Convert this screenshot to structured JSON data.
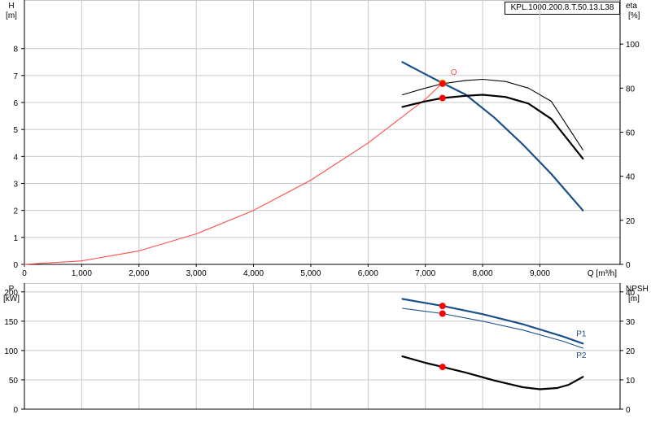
{
  "model_label": "KPL.1000.200.8.T.50.13.L38",
  "colors": {
    "h_curve": "#1b4f8a",
    "system_curve": "#ff4d4d",
    "eta_curves": "#000000",
    "p1": "#1b4f8a",
    "p2": "#1b4f8a",
    "npsh": "#000000",
    "duty_point": "#ff0000",
    "op_point_marker": "#ffd400",
    "grid": "#c8c8c8"
  },
  "chart_data": [
    {
      "type": "line",
      "x_axis": {
        "label": "Q [m³/h]",
        "range": [
          0,
          10400
        ],
        "ticks": [
          0,
          1000,
          2000,
          3000,
          4000,
          5000,
          6000,
          7000,
          8000,
          9000
        ],
        "tick_labels": [
          "0",
          "1,000",
          "2,000",
          "3,000",
          "4,000",
          "5,000",
          "6,000",
          "7,000",
          "8,000",
          "9,000"
        ]
      },
      "left_axis": {
        "label_top": "H",
        "label_unit": "[m]",
        "range": [
          0,
          9.8
        ],
        "ticks": [
          0,
          1,
          2,
          3,
          4,
          5,
          6,
          7,
          8
        ],
        "tick_labels": [
          "0",
          "1",
          "2",
          "3",
          "4",
          "5",
          "6",
          "7",
          "8"
        ]
      },
      "right_axis": {
        "label_top": "eta",
        "label_unit": "[%]",
        "range": [
          0,
          120
        ],
        "ticks": [
          0,
          20,
          40,
          60,
          80,
          100
        ],
        "tick_labels": [
          "0",
          "20",
          "40",
          "60",
          "80",
          "100"
        ]
      },
      "grid": true,
      "series": [
        {
          "id": "h",
          "axis": "left",
          "style": "thick",
          "x": [
            6600,
            7000,
            7300,
            7700,
            8200,
            8700,
            9200,
            9750
          ],
          "y": [
            7.5,
            7.05,
            6.72,
            6.3,
            5.45,
            4.45,
            3.35,
            2.0
          ]
        },
        {
          "id": "system",
          "axis": "left",
          "style": "thin",
          "x": [
            0,
            1000,
            2000,
            3000,
            4000,
            5000,
            6000,
            7000,
            7300
          ],
          "y": [
            0,
            0.13,
            0.5,
            1.13,
            2.0,
            3.12,
            4.5,
            6.12,
            6.72
          ],
          "end_label": "O"
        },
        {
          "id": "eta1",
          "axis": "right",
          "style": "thin",
          "x": [
            6600,
            7000,
            7300,
            7700,
            8000,
            8400,
            8800,
            9200,
            9750
          ],
          "y": [
            77,
            80,
            82,
            83.5,
            84,
            83,
            80,
            74,
            52
          ]
        },
        {
          "id": "eta2",
          "axis": "right",
          "style": "thick",
          "x": [
            6600,
            7000,
            7300,
            7700,
            8000,
            8400,
            8800,
            9200,
            9750
          ],
          "y": [
            71.5,
            74,
            75.5,
            76.5,
            77,
            76,
            73,
            66,
            48
          ]
        }
      ],
      "duty_points": [
        {
          "axis": "left",
          "x": 7300,
          "y": 6.72,
          "marker": "yellow"
        },
        {
          "axis": "right",
          "x": 7300,
          "y": 82,
          "marker": "red"
        },
        {
          "axis": "right",
          "x": 7300,
          "y": 75.5,
          "marker": "red"
        }
      ]
    },
    {
      "type": "line",
      "x_axis": {
        "range": [
          0,
          10400
        ]
      },
      "left_axis": {
        "label_top": "P",
        "label_unit": "[kW]",
        "range": [
          0,
          215
        ],
        "ticks": [
          0,
          50,
          100,
          150,
          200
        ],
        "tick_labels": [
          "0",
          "50",
          "100",
          "150",
          "200"
        ]
      },
      "right_axis": {
        "label_top": "NPSH",
        "label_unit": "[m]",
        "range": [
          0,
          43
        ],
        "ticks": [
          0,
          10,
          20,
          30,
          40
        ],
        "tick_labels": [
          "0",
          "10",
          "20",
          "30",
          "40"
        ]
      },
      "grid": true,
      "series": [
        {
          "id": "p1",
          "name": "P1",
          "axis": "left",
          "style": "thick",
          "x": [
            6600,
            7300,
            8000,
            8700,
            9400,
            9750
          ],
          "y": [
            188,
            176,
            162,
            145,
            124,
            112
          ]
        },
        {
          "id": "p2",
          "name": "P2",
          "axis": "left",
          "style": "thin",
          "x": [
            6600,
            7300,
            8000,
            8700,
            9400,
            9750
          ],
          "y": [
            172,
            163,
            150,
            135,
            116,
            104
          ]
        },
        {
          "id": "npsh",
          "axis": "right",
          "style": "thick",
          "x": [
            6600,
            7000,
            7300,
            7700,
            8200,
            8700,
            9000,
            9300,
            9500,
            9750
          ],
          "y": [
            18,
            15.8,
            14.4,
            12.5,
            9.8,
            7.5,
            6.8,
            7.2,
            8.3,
            11
          ]
        }
      ],
      "duty_points": [
        {
          "axis": "left",
          "x": 7300,
          "y": 176,
          "marker": "red"
        },
        {
          "axis": "left",
          "x": 7300,
          "y": 163,
          "marker": "red"
        },
        {
          "axis": "right",
          "x": 7300,
          "y": 14.4,
          "marker": "red"
        }
      ]
    }
  ]
}
